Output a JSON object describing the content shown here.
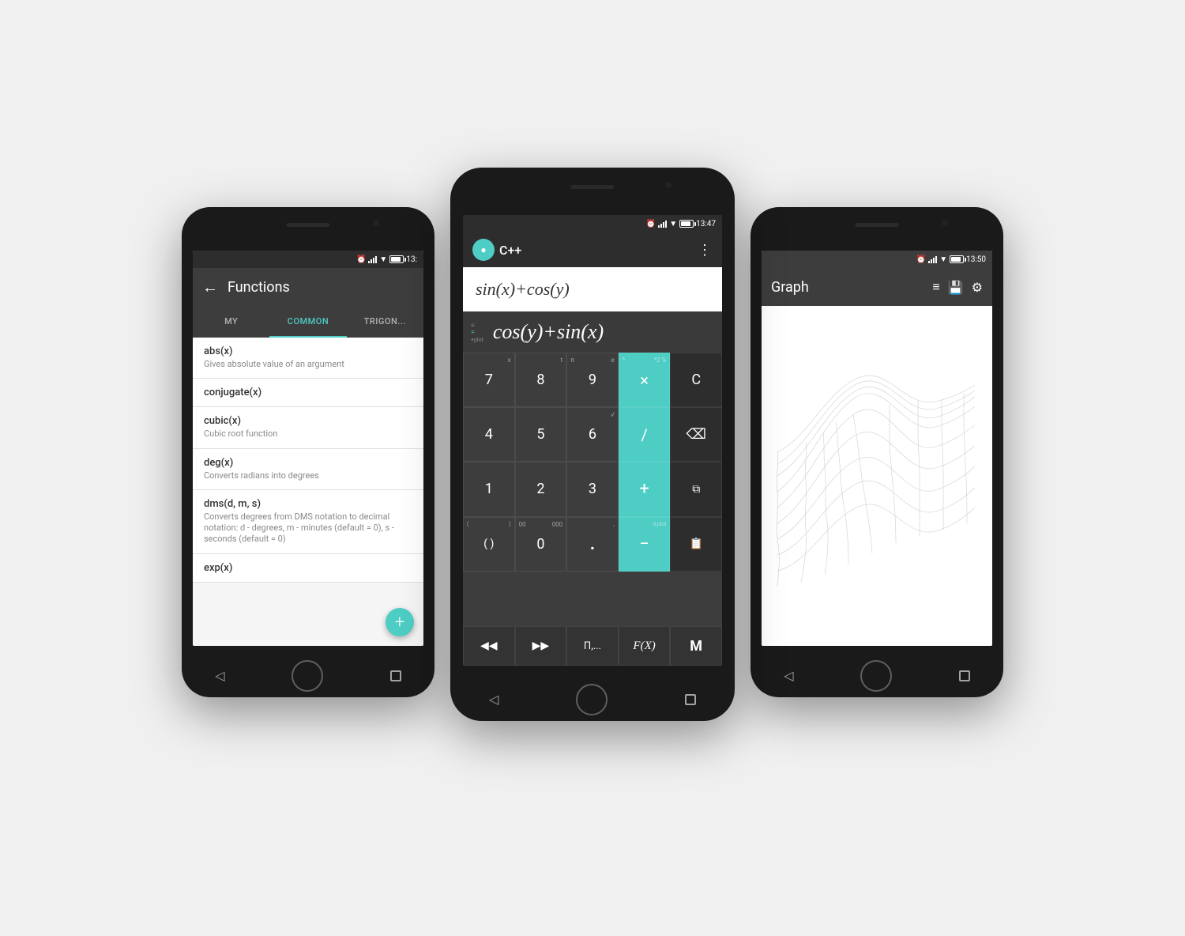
{
  "scene": {
    "background": "#f0f0f0"
  },
  "leftPhone": {
    "statusTime": "13:",
    "screenTitle": "Functions",
    "tabs": [
      {
        "label": "MY",
        "active": false
      },
      {
        "label": "COMMON",
        "active": true
      },
      {
        "label": "TRIGON...",
        "active": false
      }
    ],
    "functions": [
      {
        "name": "abs(x)",
        "desc": "Gives absolute value of an argument"
      },
      {
        "name": "conjugate(x)",
        "desc": ""
      },
      {
        "name": "cubic(x)",
        "desc": "Cubic root function"
      },
      {
        "name": "deg(x)",
        "desc": "Converts radians into degrees"
      },
      {
        "name": "dms(d, m, s)",
        "desc": "Converts degrees from DMS notation to decimal notation: d - degrees, m - minutes (default = 0), s - seconds (default = 0)"
      },
      {
        "name": "exp(x)",
        "desc": ""
      }
    ],
    "fabLabel": "+"
  },
  "centerPhone": {
    "statusTime": "13:47",
    "appName": "C++",
    "expression": "sin(x)+cos(y)",
    "resultEquals": "=",
    "resultValue": "cos(y)+sin(x)",
    "keys": [
      {
        "label": "7",
        "type": "normal"
      },
      {
        "label": "8",
        "type": "normal"
      },
      {
        "label": "9",
        "type": "normal"
      },
      {
        "label": "×",
        "type": "teal",
        "sup": "^",
        "sub": ""
      },
      {
        "label": "C",
        "type": "dark"
      },
      {
        "label": "4",
        "type": "normal"
      },
      {
        "label": "5",
        "type": "normal"
      },
      {
        "label": "6",
        "type": "normal"
      },
      {
        "label": "/",
        "type": "teal"
      },
      {
        "label": "⌫",
        "type": "dark"
      },
      {
        "label": "1",
        "type": "normal"
      },
      {
        "label": "2",
        "type": "normal"
      },
      {
        "label": "3",
        "type": "normal"
      },
      {
        "label": "+",
        "type": "teal"
      },
      {
        "label": "⧉",
        "type": "dark"
      },
      {
        "label": "()",
        "type": "normal"
      },
      {
        "label": "0",
        "type": "normal"
      },
      {
        "label": ".",
        "type": "normal"
      },
      {
        "label": "−",
        "type": "teal"
      },
      {
        "label": "📋",
        "type": "dark"
      }
    ],
    "bottomKeys": [
      {
        "label": "◀"
      },
      {
        "label": "▶"
      },
      {
        "label": "П,..."
      },
      {
        "label": "F(X)"
      },
      {
        "label": "M"
      }
    ]
  },
  "rightPhone": {
    "statusTime": "13:50",
    "screenTitle": "Graph",
    "icons": [
      "list",
      "save",
      "settings"
    ]
  }
}
